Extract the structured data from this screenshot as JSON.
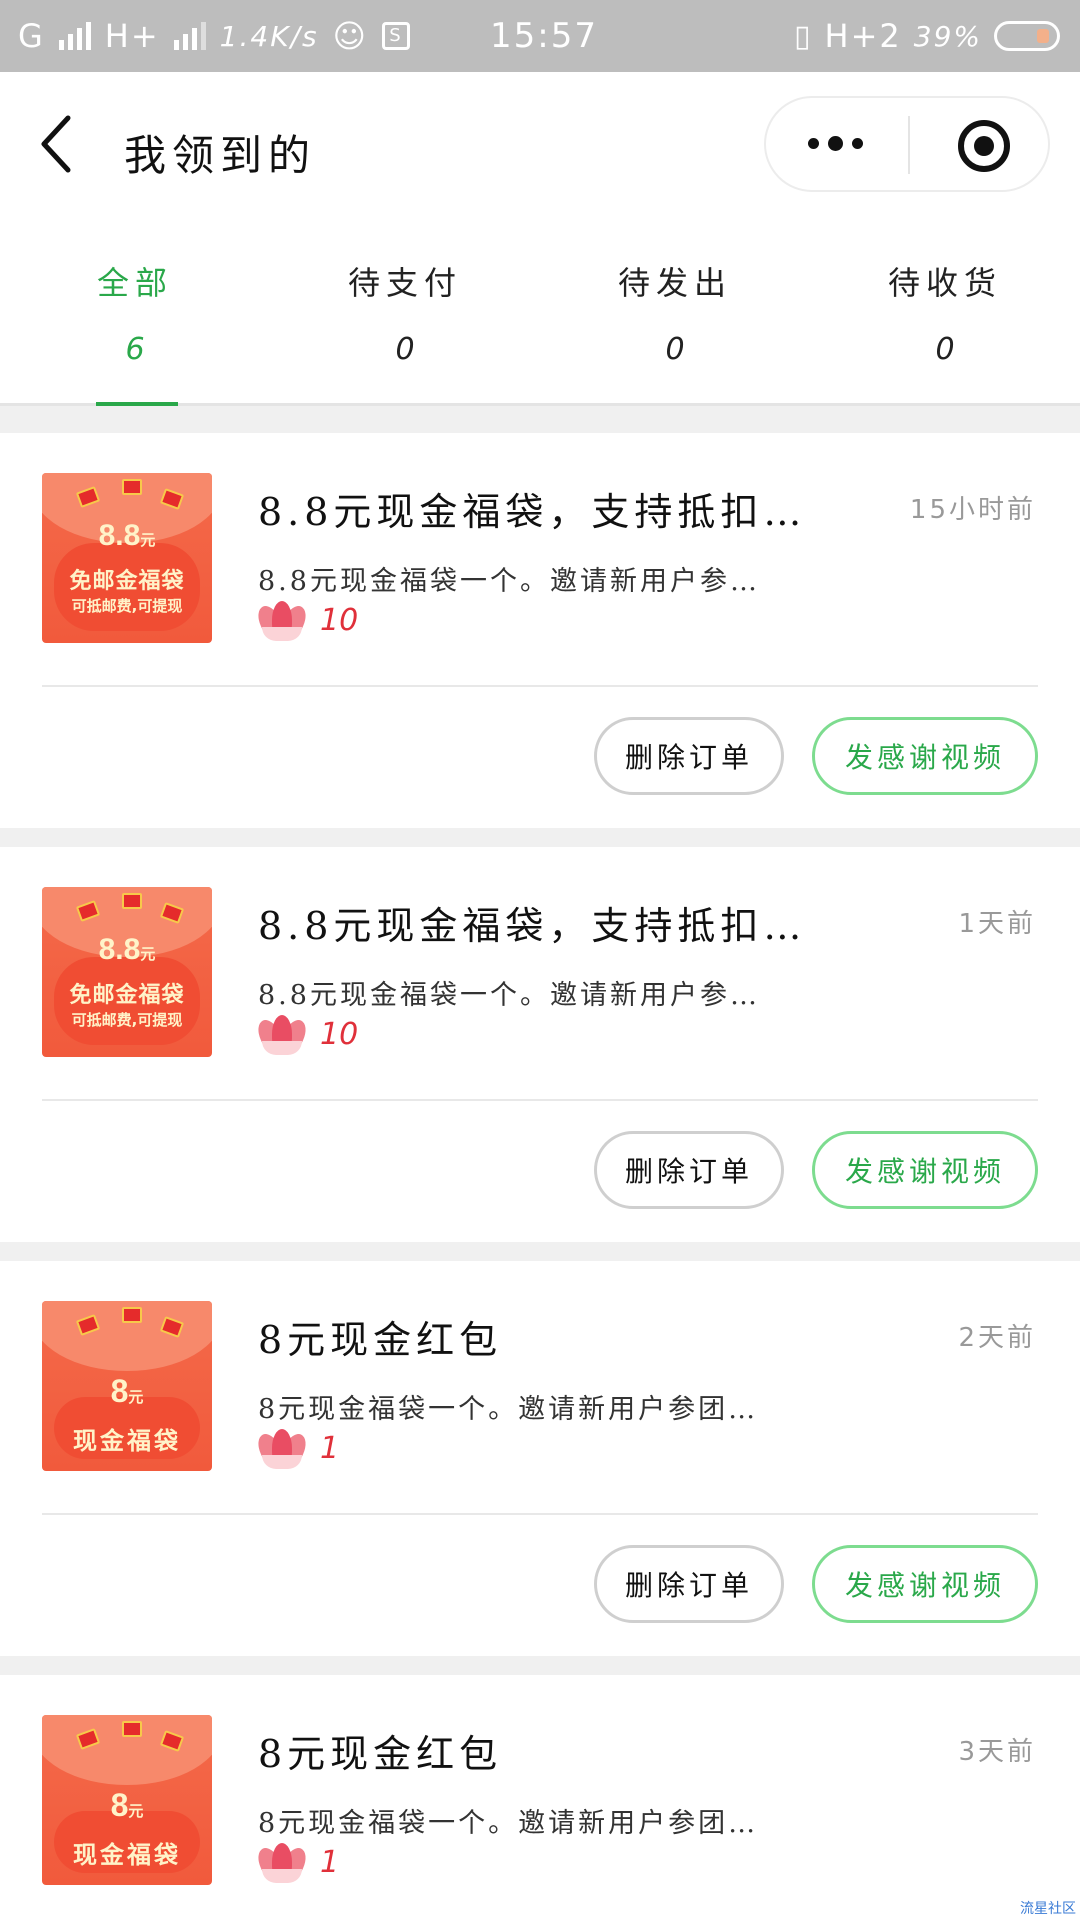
{
  "status_bar": {
    "network_left": "G",
    "network_right": "H+",
    "speed": "1.4K/s",
    "time": "15:57",
    "network_2": "H+2",
    "battery": "39%"
  },
  "header": {
    "title": "我领到的"
  },
  "tabs": [
    {
      "label": "全部",
      "count": "6",
      "active": true
    },
    {
      "label": "待支付",
      "count": "0",
      "active": false
    },
    {
      "label": "待发出",
      "count": "0",
      "active": false
    },
    {
      "label": "待收货",
      "count": "0",
      "active": false
    }
  ],
  "orders": [
    {
      "title": "8.8元现金福袋，支持抵扣…",
      "time": "15小时前",
      "desc": "8.8元现金福袋一个。邀请新用户参…",
      "price": "10",
      "thumb": {
        "amount": "8.8",
        "unit": "元",
        "main": "免邮金福袋",
        "sub": "可抵邮费,可提现"
      },
      "delete_label": "删除订单",
      "thanks_label": "发感谢视频"
    },
    {
      "title": "8.8元现金福袋，支持抵扣…",
      "time": "1天前",
      "desc": "8.8元现金福袋一个。邀请新用户参…",
      "price": "10",
      "thumb": {
        "amount": "8.8",
        "unit": "元",
        "main": "免邮金福袋",
        "sub": "可抵邮费,可提现"
      },
      "delete_label": "删除订单",
      "thanks_label": "发感谢视频"
    },
    {
      "title": "8元现金红包",
      "time": "2天前",
      "desc": "8元现金福袋一个。邀请新用户参团…",
      "price": "1",
      "thumb": {
        "amount": "8",
        "unit": "元",
        "main": "现金福袋",
        "sub": ""
      },
      "delete_label": "删除订单",
      "thanks_label": "发感谢视频"
    },
    {
      "title": "8元现金红包",
      "time": "3天前",
      "desc": "8元现金福袋一个。邀请新用户参团…",
      "price": "1",
      "thumb": {
        "amount": "8",
        "unit": "元",
        "main": "现金福袋",
        "sub": ""
      }
    }
  ],
  "watermark": "流星社区"
}
